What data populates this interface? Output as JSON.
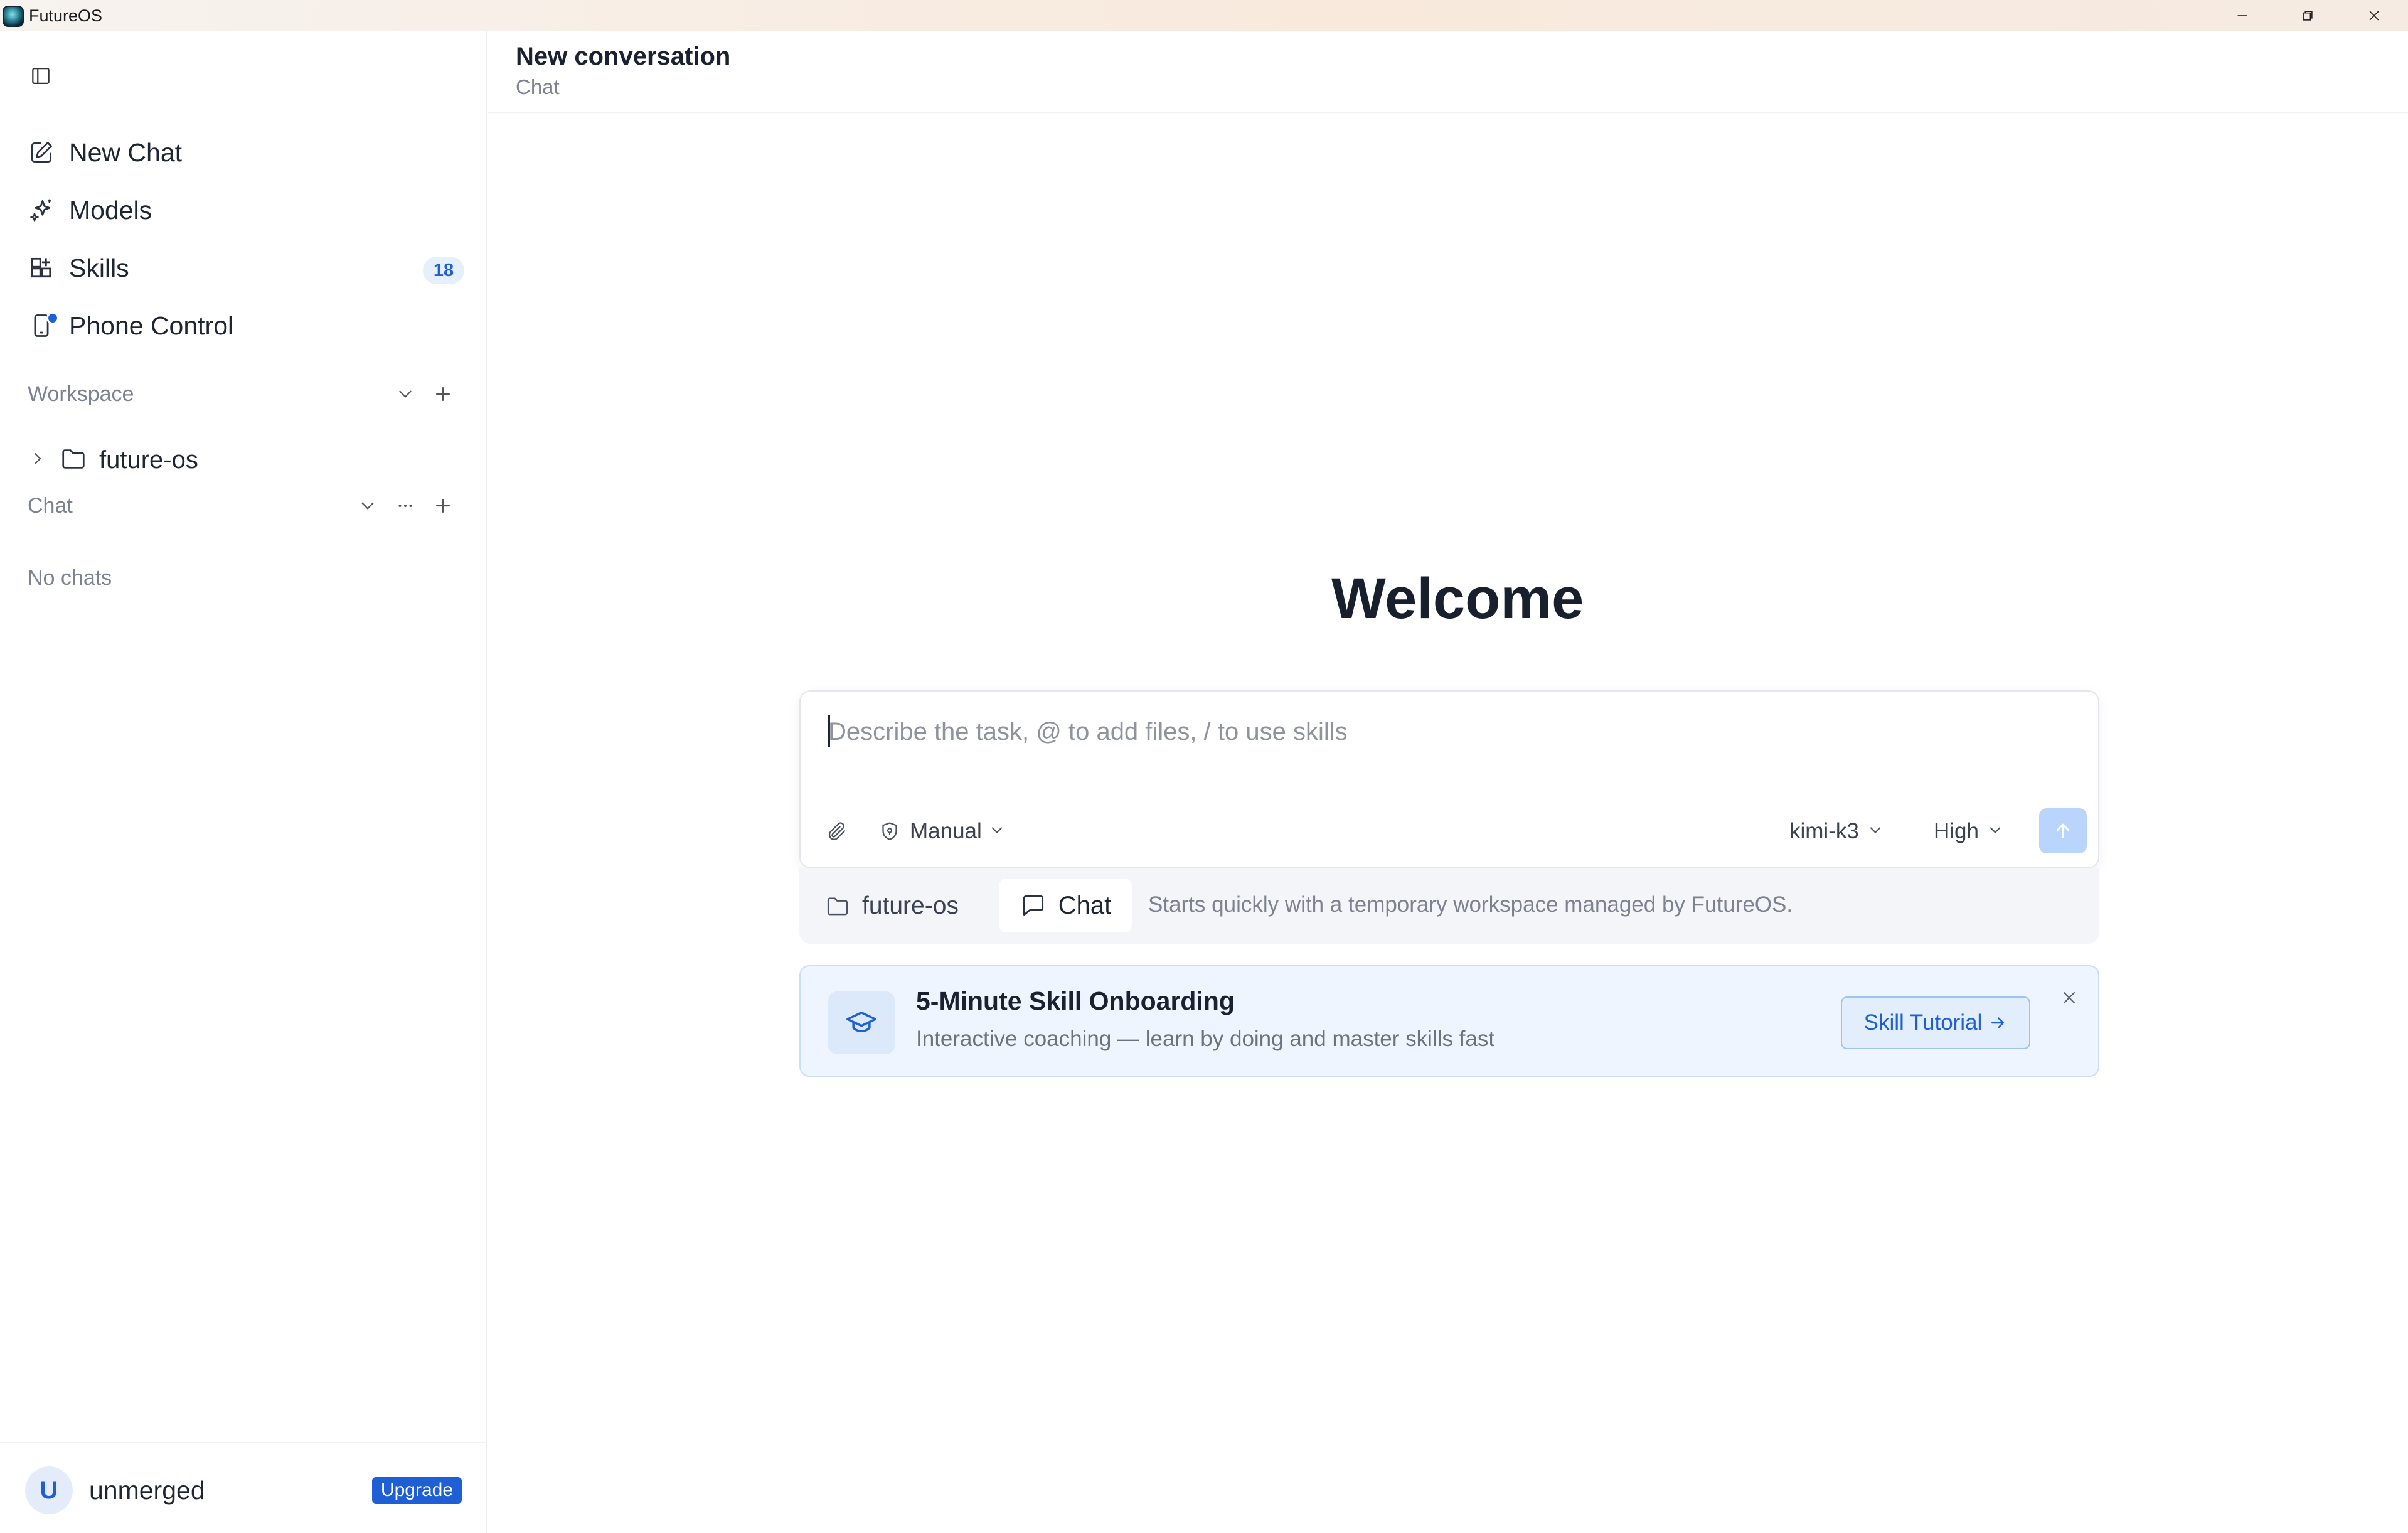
{
  "window": {
    "app_title": "FutureOS"
  },
  "sidebar": {
    "nav": [
      {
        "label": "New Chat",
        "icon": "edit-icon"
      },
      {
        "label": "Models",
        "icon": "sparkles-icon"
      },
      {
        "label": "Skills",
        "icon": "grid-plus-icon",
        "badge": "18"
      },
      {
        "label": "Phone Control",
        "icon": "phone-icon"
      }
    ],
    "workspace": {
      "title": "Workspace",
      "items": [
        {
          "label": "future-os"
        }
      ]
    },
    "chat": {
      "title": "Chat",
      "empty": "No chats"
    },
    "user": {
      "initial": "U",
      "name": "unmerged",
      "upgrade": "Upgrade"
    }
  },
  "header": {
    "title": "New conversation",
    "subtitle": "Chat"
  },
  "main": {
    "welcome": "Welcome",
    "composer": {
      "placeholder": "Describe the task, @ to add files, / to use skills",
      "mode": "Manual",
      "model": "kimi-k3",
      "effort": "High"
    },
    "mode_bar": {
      "folder": "future-os",
      "chat": "Chat",
      "description": "Starts quickly with a temporary workspace managed by FutureOS."
    },
    "onboarding": {
      "title": "5-Minute Skill Onboarding",
      "subtitle": "Interactive coaching — learn by doing and master skills fast",
      "button": "Skill Tutorial"
    }
  },
  "colors": {
    "accent": "#1f5fd6",
    "send_disabled": "#b9d5fb",
    "onboarding_bg": "#eef5fe"
  }
}
